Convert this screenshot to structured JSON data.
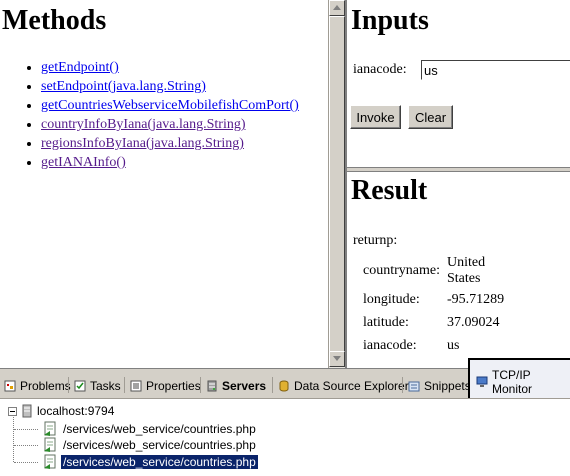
{
  "methods": {
    "title": "Methods",
    "items": [
      {
        "label": "getEndpoint()",
        "visited": false
      },
      {
        "label": "setEndpoint(java.lang.String)",
        "visited": false
      },
      {
        "label": "getCountriesWebserviceMobilefishComPort()",
        "visited": false
      },
      {
        "label": "countryInfoByIana(java.lang.String)",
        "visited": true
      },
      {
        "label": "regionsInfoByIana(java.lang.String)",
        "visited": true
      },
      {
        "label": "getIANAInfo()",
        "visited": true
      }
    ]
  },
  "inputs": {
    "title": "Inputs",
    "field_label": "ianacode:",
    "field_value": "us",
    "invoke_label": "Invoke",
    "clear_label": "Clear"
  },
  "result": {
    "title": "Result",
    "return_label": "returnp:",
    "rows": [
      {
        "key": "countryname:",
        "value": "United States"
      },
      {
        "key": "longitude:",
        "value": "-95.71289"
      },
      {
        "key": "latitude:",
        "value": "37.09024"
      },
      {
        "key": "ianacode:",
        "value": "us"
      }
    ]
  },
  "tabs": {
    "problems": "Problems",
    "tasks": "Tasks",
    "properties": "Properties",
    "servers": "Servers",
    "data_source_explorer": "Data Source Explorer",
    "snippets": "Snippets",
    "tcpip_monitor": "TCP/IP Monitor"
  },
  "tree": {
    "root": "localhost:9794",
    "children": [
      "/services/web_service/countries.php",
      "/services/web_service/countries.php",
      "/services/web_service/countries.php"
    ],
    "selected_index": 2
  },
  "colors": {
    "link": "#0000ee",
    "visited_link": "#551a8b",
    "selection": "#0a246a",
    "chrome": "#d4d0c8"
  }
}
